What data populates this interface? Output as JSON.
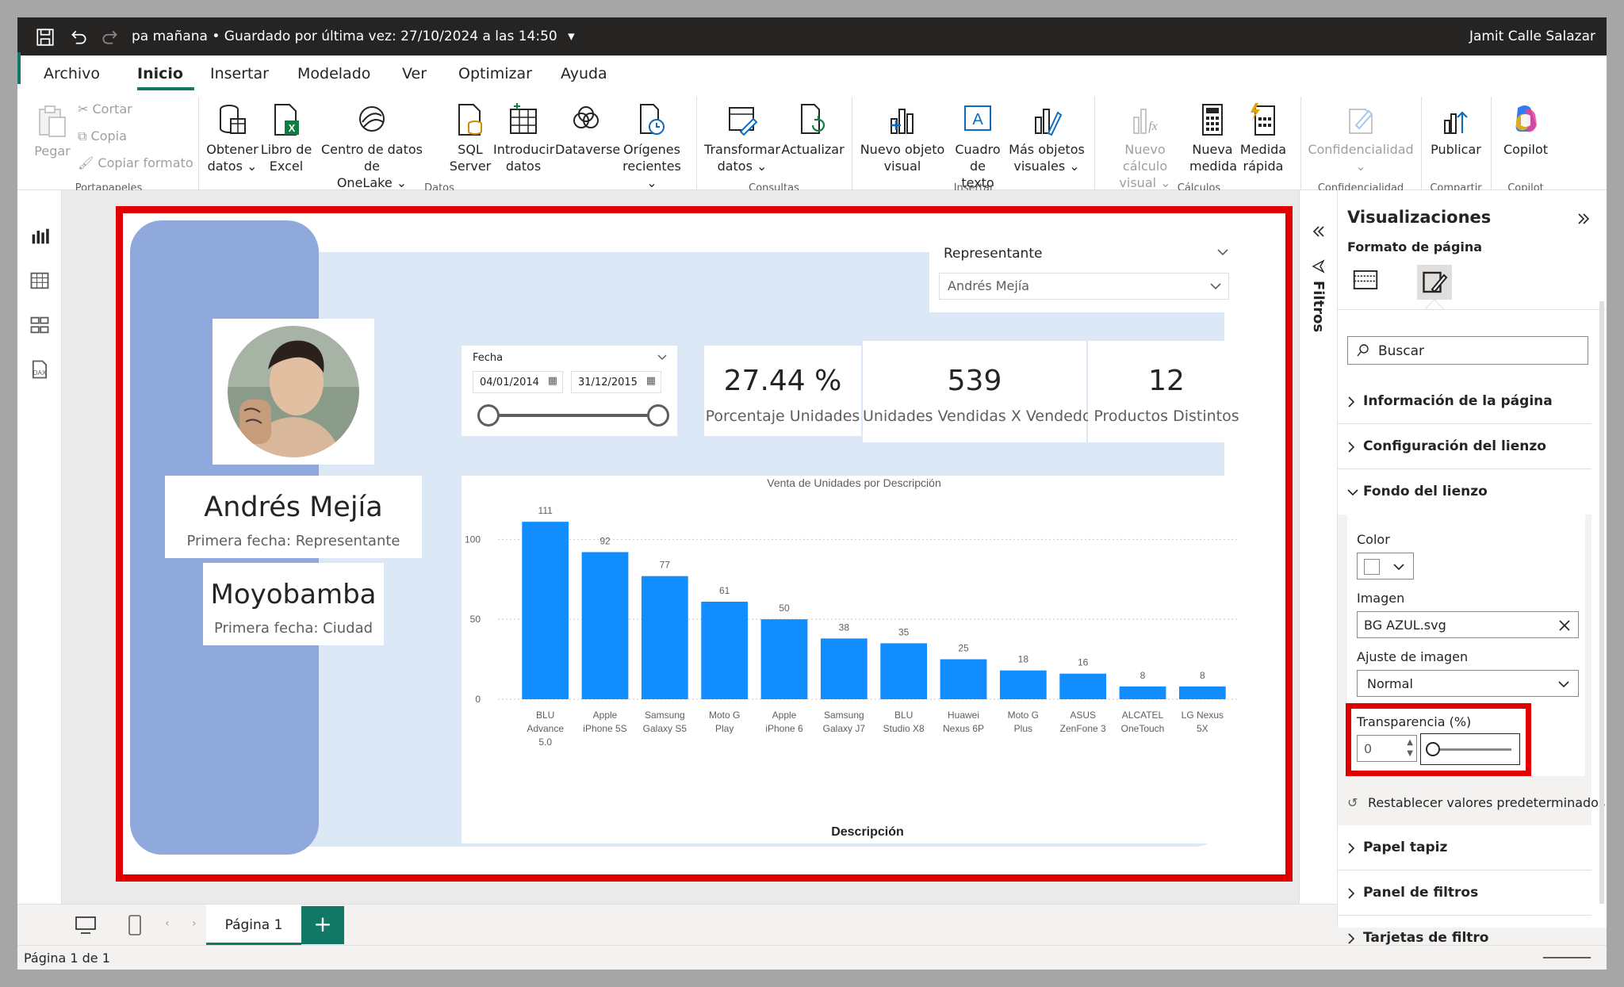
{
  "titlebar": {
    "doc_title": "pa mañana • Guardado por última vez: 27/10/2024 a las 14:50",
    "user": "Jamit Calle Salazar"
  },
  "menu": {
    "items": [
      {
        "label": "Archivo"
      },
      {
        "label": "Inicio"
      },
      {
        "label": "Insertar"
      },
      {
        "label": "Modelado"
      },
      {
        "label": "Ver"
      },
      {
        "label": "Optimizar"
      },
      {
        "label": "Ayuda"
      }
    ]
  },
  "ribbon": {
    "portapapeles": {
      "paste": "Pegar",
      "cut": "Cortar",
      "copy": "Copia",
      "format_painter": "Copiar formato",
      "label": "Portapapeles"
    },
    "datos": {
      "label": "Datos",
      "buttons": [
        {
          "l1": "Obtener",
          "l2": "datos ⌄"
        },
        {
          "l1": "Libro de",
          "l2": "Excel"
        },
        {
          "l1": "Centro de datos de",
          "l2": "OneLake ⌄"
        },
        {
          "l1": "SQL",
          "l2": "Server"
        },
        {
          "l1": "Introducir",
          "l2": "datos"
        },
        {
          "l1": "Dataverse",
          "l2": ""
        },
        {
          "l1": "Orígenes",
          "l2": "recientes ⌄"
        }
      ]
    },
    "consultas": {
      "label": "Consultas",
      "buttons": [
        {
          "l1": "Transformar",
          "l2": "datos ⌄"
        },
        {
          "l1": "Actualizar",
          "l2": ""
        }
      ]
    },
    "insertar": {
      "label": "Insertar",
      "buttons": [
        {
          "l1": "Nuevo objeto",
          "l2": "visual"
        },
        {
          "l1": "Cuadro de",
          "l2": "texto"
        },
        {
          "l1": "Más objetos",
          "l2": "visuales ⌄"
        }
      ]
    },
    "calculos": {
      "label": "Cálculos",
      "buttons": [
        {
          "l1": "Nuevo cálculo",
          "l2": "visual ⌄"
        },
        {
          "l1": "Nueva",
          "l2": "medida"
        },
        {
          "l1": "Medida",
          "l2": "rápida"
        }
      ]
    },
    "confidencialidad": {
      "label": "Confidencialidad",
      "button": "Confidencialidad",
      "chev": "⌄"
    },
    "compartir": {
      "label": "Compartir",
      "button": "Publicar"
    },
    "copilot": {
      "label": "Copilot",
      "button": "Copilot"
    }
  },
  "report": {
    "representante_title": "Representante",
    "representante_value": "Andrés Mejía",
    "fecha_title": "Fecha",
    "fecha_start": "04/01/2014",
    "fecha_end": "31/12/2015",
    "name": "Andrés Mejía",
    "name_sub": "Primera fecha: Representante",
    "city": "Moyobamba",
    "city_sub": "Primera fecha: Ciudad",
    "kpis": [
      {
        "value": "27.44 %",
        "label": "Porcentaje Unidades"
      },
      {
        "value": "539",
        "label": "Unidades Vendidas X Vendedor"
      },
      {
        "value": "12",
        "label": "Productos Distintos"
      }
    ]
  },
  "chart_data": {
    "type": "bar",
    "title": "Venta de Unidades por Descripción",
    "xlabel": "Descripción",
    "ylabel": "",
    "ylim": [
      0,
      120
    ],
    "yticks": [
      0,
      50,
      100
    ],
    "grid": true,
    "categories": [
      [
        "BLU",
        "Advance",
        "5.0"
      ],
      [
        "Apple",
        "iPhone 5S"
      ],
      [
        "Samsung",
        "Galaxy S5"
      ],
      [
        "Moto G",
        "Play"
      ],
      [
        "Apple",
        "iPhone 6"
      ],
      [
        "Samsung",
        "Galaxy J7"
      ],
      [
        "BLU",
        "Studio X8"
      ],
      [
        "Huawei",
        "Nexus 6P"
      ],
      [
        "Moto G",
        "Plus"
      ],
      [
        "ASUS",
        "ZenFone 3"
      ],
      [
        "ALCATEL",
        "OneTouch"
      ],
      [
        "LG Nexus",
        "5X"
      ]
    ],
    "values": [
      111,
      92,
      77,
      61,
      50,
      38,
      35,
      25,
      18,
      16,
      8,
      8
    ],
    "bar_color": "#118DFF"
  },
  "filters": {
    "label": "Filtros"
  },
  "viz_panel": {
    "title": "Visualizaciones",
    "subtitle": "Formato de página",
    "search_placeholder": "Buscar",
    "sections_top": [
      "Información de la página",
      "Configuración del lienzo",
      "Fondo del lienzo"
    ],
    "color_label": "Color",
    "image_label": "Imagen",
    "image_value": "BG AZUL.svg",
    "fit_label": "Ajuste de imagen",
    "fit_value": "Normal",
    "transparency_label": "Transparencia (%)",
    "transparency_value": "0",
    "reset_label": "Restablecer valores predeterminados",
    "sections_bottom": [
      "Papel tapiz",
      "Panel de filtros",
      "Tarjetas de filtro"
    ]
  },
  "pagebar": {
    "tab": "Página 1",
    "add": "+"
  },
  "status": {
    "page_info": "Página 1 de 1"
  },
  "colors": {
    "accent": "#117865",
    "highlight": "#E00000",
    "bar": "#118DFF",
    "panel_blue": "#8FA9DC",
    "panel_light": "#DDE8F7"
  }
}
